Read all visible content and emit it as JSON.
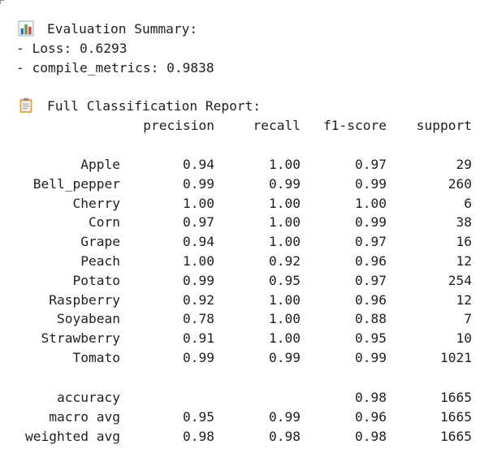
{
  "summary": {
    "icon": "bar-chart-icon",
    "title": "Evaluation Summary:",
    "loss_line": "- Loss: 0.6293",
    "metrics_line": "- compile_metrics: 0.9838"
  },
  "report": {
    "icon": "clipboard-icon",
    "title": "Full Classification Report:",
    "headers": [
      "precision",
      "recall",
      "f1-score",
      "support"
    ],
    "rows": [
      {
        "label": "Apple",
        "precision": "0.94",
        "recall": "1.00",
        "f1": "0.97",
        "support": "29"
      },
      {
        "label": "Bell_pepper",
        "precision": "0.99",
        "recall": "0.99",
        "f1": "0.99",
        "support": "260"
      },
      {
        "label": "Cherry",
        "precision": "1.00",
        "recall": "1.00",
        "f1": "1.00",
        "support": "6"
      },
      {
        "label": "Corn",
        "precision": "0.97",
        "recall": "1.00",
        "f1": "0.99",
        "support": "38"
      },
      {
        "label": "Grape",
        "precision": "0.94",
        "recall": "1.00",
        "f1": "0.97",
        "support": "16"
      },
      {
        "label": "Peach",
        "precision": "1.00",
        "recall": "0.92",
        "f1": "0.96",
        "support": "12"
      },
      {
        "label": "Potato",
        "precision": "0.99",
        "recall": "0.95",
        "f1": "0.97",
        "support": "254"
      },
      {
        "label": "Raspberry",
        "precision": "0.92",
        "recall": "1.00",
        "f1": "0.96",
        "support": "12"
      },
      {
        "label": "Soyabean",
        "precision": "0.78",
        "recall": "1.00",
        "f1": "0.88",
        "support": "7"
      },
      {
        "label": "Strawberry",
        "precision": "0.91",
        "recall": "1.00",
        "f1": "0.95",
        "support": "10"
      },
      {
        "label": "Tomato",
        "precision": "0.99",
        "recall": "0.99",
        "f1": "0.99",
        "support": "1021"
      }
    ],
    "summary_rows": [
      {
        "label": "accuracy",
        "precision": "",
        "recall": "",
        "f1": "0.98",
        "support": "1665"
      },
      {
        "label": "macro avg",
        "precision": "0.95",
        "recall": "0.99",
        "f1": "0.96",
        "support": "1665"
      },
      {
        "label": "weighted avg",
        "precision": "0.98",
        "recall": "0.98",
        "f1": "0.98",
        "support": "1665"
      }
    ]
  },
  "colors": {
    "text": "#1f1f1f",
    "bar_blue": "#3a6ec4",
    "bar_green": "#53a44a",
    "bar_red": "#d9443a",
    "clipboard_board": "#e7a64a",
    "clipboard_paper": "#f4f4f4"
  }
}
